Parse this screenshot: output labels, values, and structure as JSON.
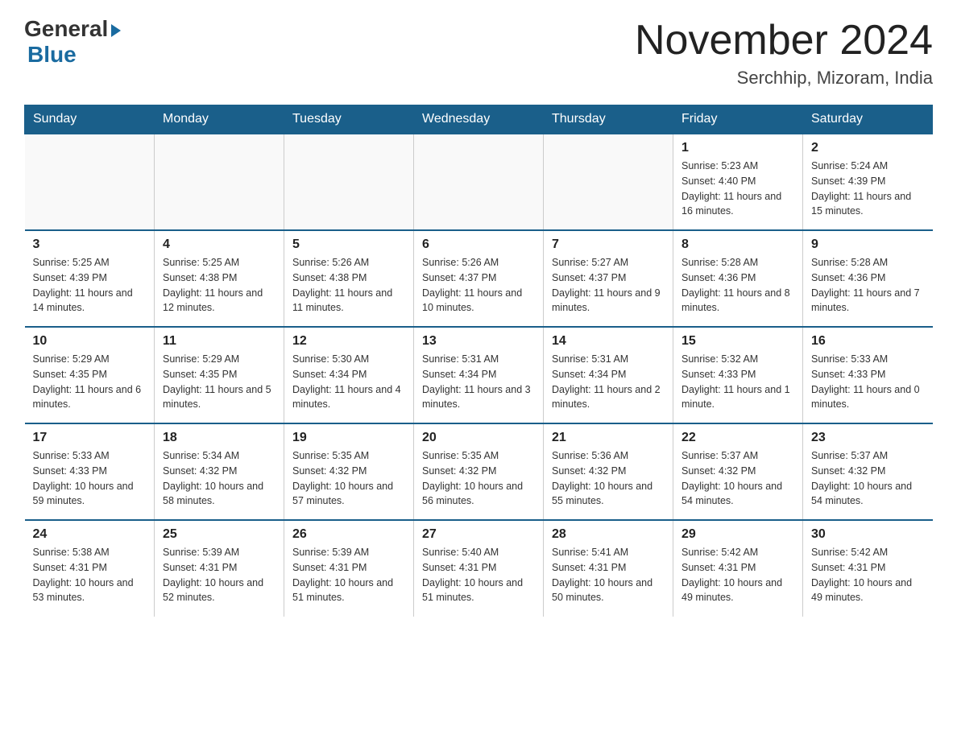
{
  "logo": {
    "general": "General",
    "blue": "Blue"
  },
  "title": "November 2024",
  "location": "Serchhip, Mizoram, India",
  "days_of_week": [
    "Sunday",
    "Monday",
    "Tuesday",
    "Wednesday",
    "Thursday",
    "Friday",
    "Saturday"
  ],
  "weeks": [
    [
      {
        "day": "",
        "info": ""
      },
      {
        "day": "",
        "info": ""
      },
      {
        "day": "",
        "info": ""
      },
      {
        "day": "",
        "info": ""
      },
      {
        "day": "",
        "info": ""
      },
      {
        "day": "1",
        "info": "Sunrise: 5:23 AM\nSunset: 4:40 PM\nDaylight: 11 hours and 16 minutes."
      },
      {
        "day": "2",
        "info": "Sunrise: 5:24 AM\nSunset: 4:39 PM\nDaylight: 11 hours and 15 minutes."
      }
    ],
    [
      {
        "day": "3",
        "info": "Sunrise: 5:25 AM\nSunset: 4:39 PM\nDaylight: 11 hours and 14 minutes."
      },
      {
        "day": "4",
        "info": "Sunrise: 5:25 AM\nSunset: 4:38 PM\nDaylight: 11 hours and 12 minutes."
      },
      {
        "day": "5",
        "info": "Sunrise: 5:26 AM\nSunset: 4:38 PM\nDaylight: 11 hours and 11 minutes."
      },
      {
        "day": "6",
        "info": "Sunrise: 5:26 AM\nSunset: 4:37 PM\nDaylight: 11 hours and 10 minutes."
      },
      {
        "day": "7",
        "info": "Sunrise: 5:27 AM\nSunset: 4:37 PM\nDaylight: 11 hours and 9 minutes."
      },
      {
        "day": "8",
        "info": "Sunrise: 5:28 AM\nSunset: 4:36 PM\nDaylight: 11 hours and 8 minutes."
      },
      {
        "day": "9",
        "info": "Sunrise: 5:28 AM\nSunset: 4:36 PM\nDaylight: 11 hours and 7 minutes."
      }
    ],
    [
      {
        "day": "10",
        "info": "Sunrise: 5:29 AM\nSunset: 4:35 PM\nDaylight: 11 hours and 6 minutes."
      },
      {
        "day": "11",
        "info": "Sunrise: 5:29 AM\nSunset: 4:35 PM\nDaylight: 11 hours and 5 minutes."
      },
      {
        "day": "12",
        "info": "Sunrise: 5:30 AM\nSunset: 4:34 PM\nDaylight: 11 hours and 4 minutes."
      },
      {
        "day": "13",
        "info": "Sunrise: 5:31 AM\nSunset: 4:34 PM\nDaylight: 11 hours and 3 minutes."
      },
      {
        "day": "14",
        "info": "Sunrise: 5:31 AM\nSunset: 4:34 PM\nDaylight: 11 hours and 2 minutes."
      },
      {
        "day": "15",
        "info": "Sunrise: 5:32 AM\nSunset: 4:33 PM\nDaylight: 11 hours and 1 minute."
      },
      {
        "day": "16",
        "info": "Sunrise: 5:33 AM\nSunset: 4:33 PM\nDaylight: 11 hours and 0 minutes."
      }
    ],
    [
      {
        "day": "17",
        "info": "Sunrise: 5:33 AM\nSunset: 4:33 PM\nDaylight: 10 hours and 59 minutes."
      },
      {
        "day": "18",
        "info": "Sunrise: 5:34 AM\nSunset: 4:32 PM\nDaylight: 10 hours and 58 minutes."
      },
      {
        "day": "19",
        "info": "Sunrise: 5:35 AM\nSunset: 4:32 PM\nDaylight: 10 hours and 57 minutes."
      },
      {
        "day": "20",
        "info": "Sunrise: 5:35 AM\nSunset: 4:32 PM\nDaylight: 10 hours and 56 minutes."
      },
      {
        "day": "21",
        "info": "Sunrise: 5:36 AM\nSunset: 4:32 PM\nDaylight: 10 hours and 55 minutes."
      },
      {
        "day": "22",
        "info": "Sunrise: 5:37 AM\nSunset: 4:32 PM\nDaylight: 10 hours and 54 minutes."
      },
      {
        "day": "23",
        "info": "Sunrise: 5:37 AM\nSunset: 4:32 PM\nDaylight: 10 hours and 54 minutes."
      }
    ],
    [
      {
        "day": "24",
        "info": "Sunrise: 5:38 AM\nSunset: 4:31 PM\nDaylight: 10 hours and 53 minutes."
      },
      {
        "day": "25",
        "info": "Sunrise: 5:39 AM\nSunset: 4:31 PM\nDaylight: 10 hours and 52 minutes."
      },
      {
        "day": "26",
        "info": "Sunrise: 5:39 AM\nSunset: 4:31 PM\nDaylight: 10 hours and 51 minutes."
      },
      {
        "day": "27",
        "info": "Sunrise: 5:40 AM\nSunset: 4:31 PM\nDaylight: 10 hours and 51 minutes."
      },
      {
        "day": "28",
        "info": "Sunrise: 5:41 AM\nSunset: 4:31 PM\nDaylight: 10 hours and 50 minutes."
      },
      {
        "day": "29",
        "info": "Sunrise: 5:42 AM\nSunset: 4:31 PM\nDaylight: 10 hours and 49 minutes."
      },
      {
        "day": "30",
        "info": "Sunrise: 5:42 AM\nSunset: 4:31 PM\nDaylight: 10 hours and 49 minutes."
      }
    ]
  ]
}
